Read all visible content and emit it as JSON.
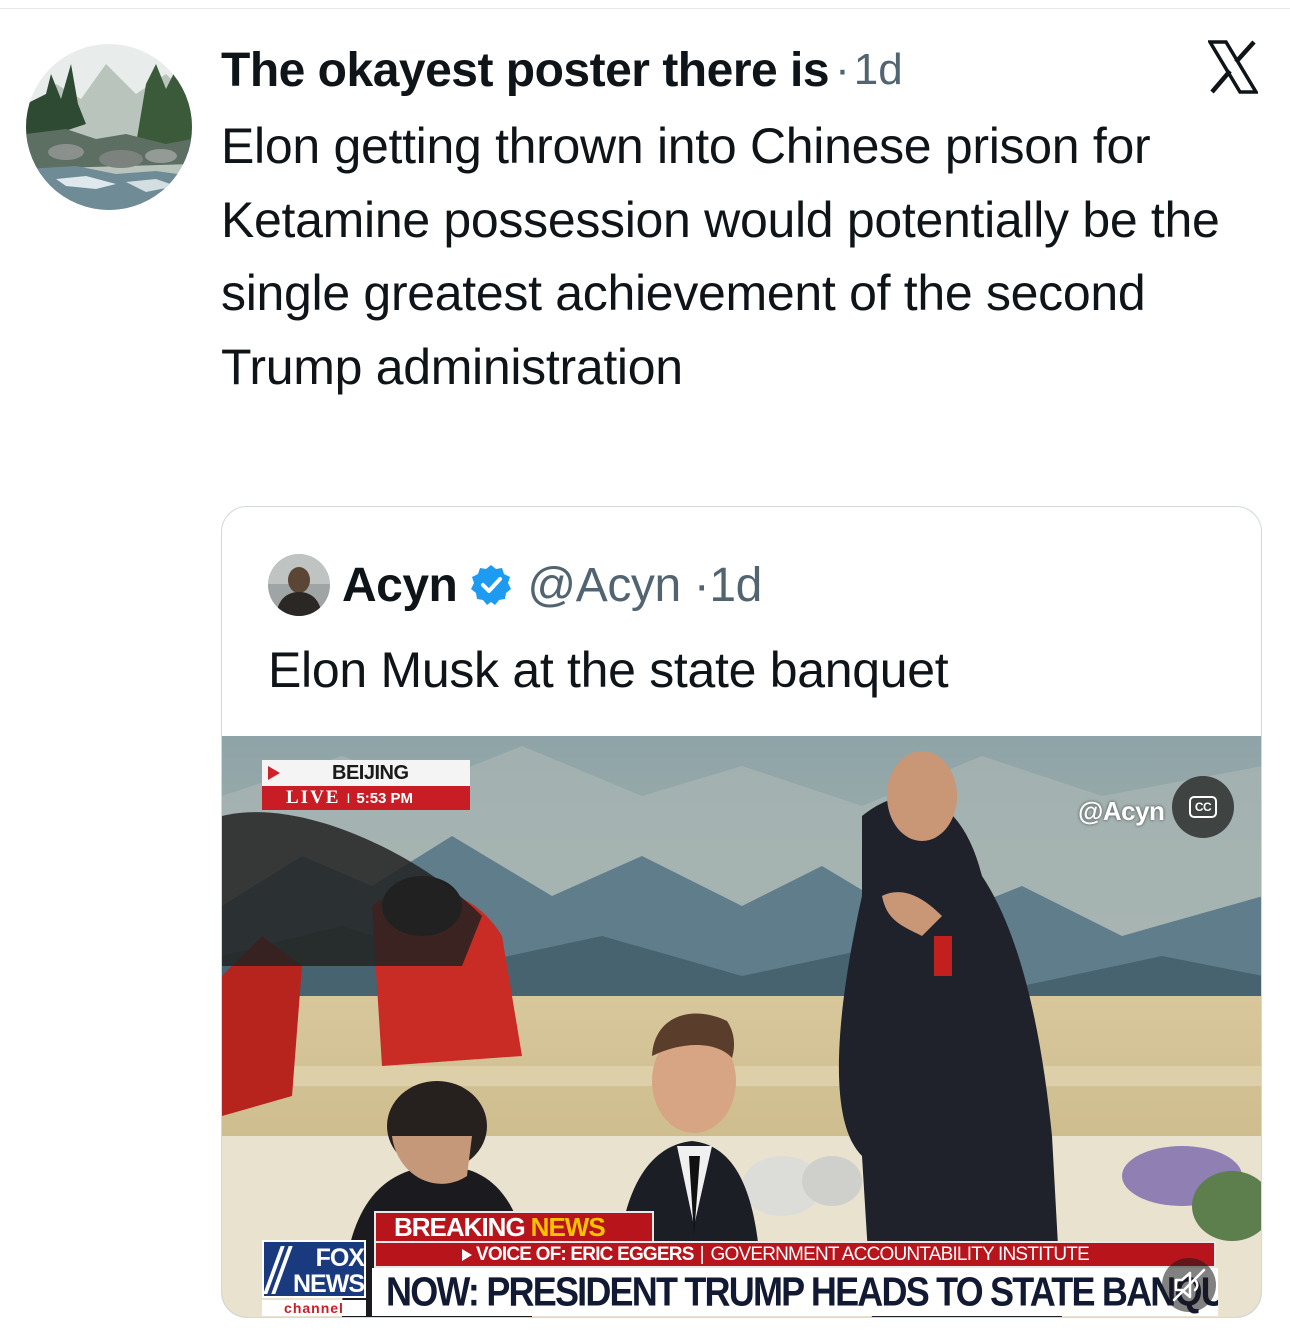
{
  "tweet": {
    "author_name": "The okayest poster there is",
    "separator": "·",
    "timestamp": "1d",
    "text": "Elon getting thrown into Chinese prison for Ketamine possession would potentially be the single greatest achievement of the second Trump administration"
  },
  "brand_icon": "x-logo-icon",
  "quoted_tweet": {
    "author_name": "Acyn",
    "verified_icon": "verified-badge-icon",
    "handle": "@Acyn",
    "separator": "·",
    "timestamp": "1d",
    "text": "Elon Musk at the state banquet"
  },
  "video": {
    "location_badge": {
      "city": "BEIJING",
      "live_label": "LIVE",
      "divider": "I",
      "time": "5:53 PM"
    },
    "watermark": "@Acyn",
    "cc_label": "CC",
    "chyron": {
      "breaking_white": "BREAKING",
      "breaking_yellow": "NEWS",
      "voice_of": "VOICE OF: ERIC EGGERS",
      "divider": "|",
      "institute": "GOVERNMENT ACCOUNTABILITY INSTITUTE",
      "headline": "NOW: PRESIDENT TRUMP HEADS TO STATE BANQUET"
    },
    "network_logo": {
      "line1": "FOX",
      "line2": "NEWS",
      "line3": "channel"
    },
    "mute_icon": "muted-speaker-icon"
  },
  "colors": {
    "text_primary": "#0f1419",
    "text_secondary": "#536471",
    "verified_blue": "#1d9bf0",
    "card_border": "#cfd9de",
    "fox_red": "#b8141c",
    "fox_blue": "#1a3a80",
    "news_yellow": "#f7c200"
  }
}
